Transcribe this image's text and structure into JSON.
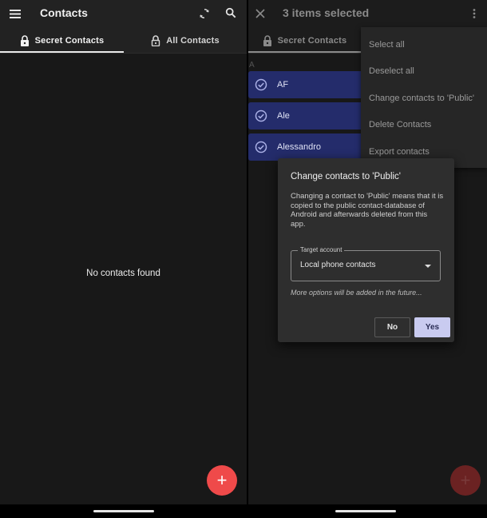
{
  "left_screen": {
    "appbar": {
      "title": "Contacts",
      "menu_icon": "hamburger-menu-icon",
      "sync_icon": "sync-icon",
      "search_icon": "search-icon"
    },
    "tabs": [
      {
        "label": "Secret Contacts",
        "icon": "lock-icon",
        "selected": true
      },
      {
        "label": "All Contacts",
        "icon": "lock-open-icon",
        "selected": false
      }
    ],
    "empty_message": "No contacts found",
    "fab": {
      "label": "+",
      "color": "#ef4a4a"
    }
  },
  "right_screen": {
    "appbar": {
      "title": "3 items selected",
      "close_icon": "close-icon",
      "overflow_icon": "more-vert-icon"
    },
    "tabs": [
      {
        "label": "Secret Contacts",
        "icon": "lock-icon",
        "selected": true
      }
    ],
    "section_letter": "A",
    "contacts": [
      {
        "name": "AF",
        "selected": true
      },
      {
        "name": "Ale",
        "selected": true
      },
      {
        "name": "Alessandro",
        "selected": true
      }
    ],
    "menu": {
      "items": [
        "Select all",
        "Deselect all",
        "Change contacts to 'Public'",
        "Delete Contacts",
        "Export contacts"
      ]
    },
    "dialog": {
      "title": "Change contacts to 'Public'",
      "body": "Changing a contact to 'Public' means that it is copied to the public contact-database of Android and afterwards deleted from this app.",
      "field_label": "Target account",
      "field_value": "Local phone contacts",
      "hint": "More options will be added in the future...",
      "no_label": "No",
      "yes_label": "Yes"
    },
    "fab": {
      "label": "+",
      "color": "#6b2222"
    }
  },
  "colors": {
    "background": "#181818",
    "appbar": "#222222",
    "selected_row": "#242c6b",
    "fab": "#ef4a4a",
    "yes_button": "#c9cbf0"
  }
}
